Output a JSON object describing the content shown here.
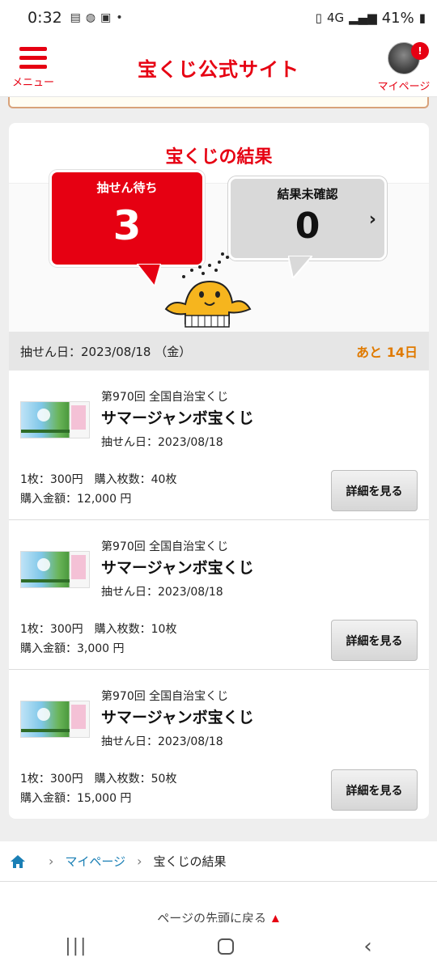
{
  "status_bar": {
    "time": "0:32",
    "network": "4G",
    "battery": "41%"
  },
  "header": {
    "menu_label": "メニュー",
    "site_title": "宝くじ公式サイト",
    "mypage_label": "マイページ",
    "notification_count": "!"
  },
  "results": {
    "title": "宝くじの結果",
    "waiting": {
      "label": "抽せん待ち",
      "count": "3"
    },
    "unchecked": {
      "label": "結果未確認",
      "count": "0"
    },
    "draw_date_label": "抽せん日：2023/08/18 （金）",
    "days_left": "あと 14日"
  },
  "items": [
    {
      "round": "第970回 全国自治宝くじ",
      "name": "サマージャンボ宝くじ",
      "draw_date": "抽せん日：2023/08/18",
      "price_line": "1枚：300円　購入枚数：40枚",
      "amount": "購入金額：12,000 円",
      "button": "詳細を見る"
    },
    {
      "round": "第970回 全国自治宝くじ",
      "name": "サマージャンボ宝くじ",
      "draw_date": "抽せん日：2023/08/18",
      "price_line": "1枚：300円　購入枚数：10枚",
      "amount": "購入金額：3,000 円",
      "button": "詳細を見る"
    },
    {
      "round": "第970回 全国自治宝くじ",
      "name": "サマージャンボ宝くじ",
      "draw_date": "抽せん日：2023/08/18",
      "price_line": "1枚：300円　購入枚数：50枚",
      "amount": "購入金額：15,000 円",
      "button": "詳細を見る"
    }
  ],
  "breadcrumb": {
    "mypage": "マイページ",
    "current": "宝くじの結果"
  },
  "back_to_top": "ページの先頭に戻る",
  "colors": {
    "brand_red": "#e60012",
    "days_left_orange": "#e07a00",
    "link_blue": "#1a7fb5"
  }
}
